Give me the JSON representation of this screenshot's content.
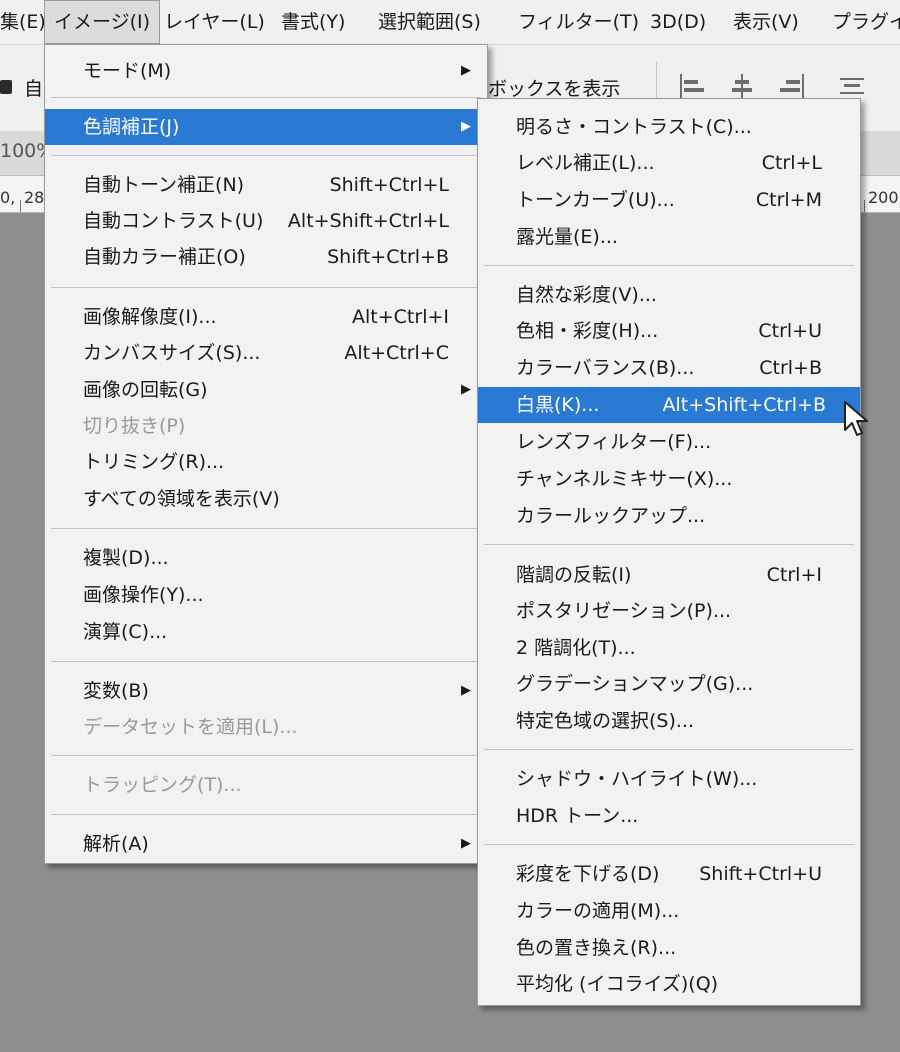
{
  "menubar": {
    "items": [
      {
        "label": "集(E)"
      },
      {
        "label": "イメージ(I)"
      },
      {
        "label": "レイヤー(L)"
      },
      {
        "label": "書式(Y)"
      },
      {
        "label": "選択範囲(S)"
      },
      {
        "label": "フィルター(T)"
      },
      {
        "label": "3D(D)"
      },
      {
        "label": "表示(V)"
      },
      {
        "label": "プラグイ"
      }
    ]
  },
  "optionsbar": {
    "auto_label": "自",
    "bounding_label": "ボックスを表示"
  },
  "doc_tab": {
    "zoom_text": "100%"
  },
  "ruler": {
    "labels": [
      "0,",
      "28",
      "200"
    ]
  },
  "image_menu": {
    "items": [
      {
        "label": "モード(M)",
        "shortcut": "",
        "submenu": true,
        "disabled": false
      },
      {
        "label": "色調補正(J)",
        "shortcut": "",
        "submenu": true,
        "disabled": false,
        "highlighted": true
      },
      {
        "label": "自動トーン補正(N)",
        "shortcut": "Shift+Ctrl+L"
      },
      {
        "label": "自動コントラスト(U)",
        "shortcut": "Alt+Shift+Ctrl+L"
      },
      {
        "label": "自動カラー補正(O)",
        "shortcut": "Shift+Ctrl+B"
      },
      {
        "label": "画像解像度(I)...",
        "shortcut": "Alt+Ctrl+I"
      },
      {
        "label": "カンバスサイズ(S)...",
        "shortcut": "Alt+Ctrl+C"
      },
      {
        "label": "画像の回転(G)",
        "shortcut": "",
        "submenu": true
      },
      {
        "label": "切り抜き(P)",
        "shortcut": "",
        "disabled": true
      },
      {
        "label": "トリミング(R)...",
        "shortcut": ""
      },
      {
        "label": "すべての領域を表示(V)",
        "shortcut": ""
      },
      {
        "label": "複製(D)...",
        "shortcut": ""
      },
      {
        "label": "画像操作(Y)...",
        "shortcut": ""
      },
      {
        "label": "演算(C)...",
        "shortcut": ""
      },
      {
        "label": "変数(B)",
        "shortcut": "",
        "submenu": true
      },
      {
        "label": "データセットを適用(L)...",
        "shortcut": "",
        "disabled": true
      },
      {
        "label": "トラッピング(T)...",
        "shortcut": "",
        "disabled": true
      },
      {
        "label": "解析(A)",
        "shortcut": "",
        "submenu": true
      }
    ]
  },
  "adjust_menu": {
    "items": [
      {
        "label": "明るさ・コントラスト(C)...",
        "shortcut": ""
      },
      {
        "label": "レベル補正(L)...",
        "shortcut": "Ctrl+L"
      },
      {
        "label": "トーンカーブ(U)...",
        "shortcut": "Ctrl+M"
      },
      {
        "label": "露光量(E)...",
        "shortcut": ""
      },
      {
        "label": "自然な彩度(V)...",
        "shortcut": ""
      },
      {
        "label": "色相・彩度(H)...",
        "shortcut": "Ctrl+U"
      },
      {
        "label": "カラーバランス(B)...",
        "shortcut": "Ctrl+B"
      },
      {
        "label": "白黒(K)...",
        "shortcut": "Alt+Shift+Ctrl+B",
        "highlighted": true
      },
      {
        "label": "レンズフィルター(F)...",
        "shortcut": ""
      },
      {
        "label": "チャンネルミキサー(X)...",
        "shortcut": ""
      },
      {
        "label": "カラールックアップ...",
        "shortcut": ""
      },
      {
        "label": "階調の反転(I)",
        "shortcut": "Ctrl+I"
      },
      {
        "label": "ポスタリゼーション(P)...",
        "shortcut": ""
      },
      {
        "label": "2 階調化(T)...",
        "shortcut": ""
      },
      {
        "label": "グラデーションマップ(G)...",
        "shortcut": ""
      },
      {
        "label": "特定色域の選択(S)...",
        "shortcut": ""
      },
      {
        "label": "シャドウ・ハイライト(W)...",
        "shortcut": ""
      },
      {
        "label": "HDR トーン...",
        "shortcut": ""
      },
      {
        "label": "彩度を下げる(D)",
        "shortcut": "Shift+Ctrl+U"
      },
      {
        "label": "カラーの適用(M)...",
        "shortcut": ""
      },
      {
        "label": "色の置き換え(R)...",
        "shortcut": ""
      },
      {
        "label": "平均化 (イコライズ)(Q)",
        "shortcut": ""
      }
    ]
  },
  "colors": {
    "highlight": "#2a79d3",
    "menu_bg": "#f2f2f2",
    "canvas_bg": "#8e8e8e",
    "disabled_text": "#9a9a9a"
  }
}
